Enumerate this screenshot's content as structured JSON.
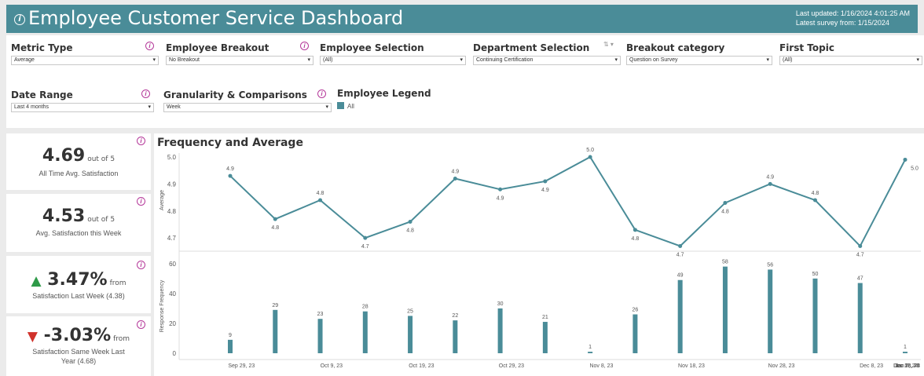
{
  "header": {
    "info_icon": "i",
    "title": "Employee Customer Service Dashboard",
    "last_updated": "Last updated: 1/16/2024 4:01:25 AM",
    "latest_survey": "Latest survey from: 1/15/2024"
  },
  "filters": {
    "metric_type": {
      "label": "Metric Type",
      "value": "Average"
    },
    "employee_breakout": {
      "label": "Employee Breakout",
      "value": "No Breakout"
    },
    "employee_selection": {
      "label": "Employee Selection",
      "value": "(All)"
    },
    "department_selection": {
      "label": "Department Selection",
      "value": "Continuing Certification"
    },
    "breakout_category": {
      "label": "Breakout category",
      "value": "Question on Survey"
    },
    "first_topic": {
      "label": "First Topic",
      "value": "(All)"
    },
    "date_range": {
      "label": "Date Range",
      "value": "Last 4 months"
    },
    "granularity": {
      "label": "Granularity & Comparisons",
      "value": "Week"
    },
    "employee_legend": {
      "label": "Employee Legend",
      "item": "All"
    }
  },
  "kpis": [
    {
      "value": "4.69",
      "suffix": "out of 5",
      "caption": "All Time Avg. Satisfaction"
    },
    {
      "value": "4.53",
      "suffix": "out of 5",
      "caption": "Avg. Satisfaction this Week"
    },
    {
      "arrow": "▲",
      "value": "3.47%",
      "suffix": "from",
      "caption": "Satisfaction Last Week (4.38)"
    },
    {
      "arrow": "▼",
      "value": "-3.03%",
      "suffix": "from",
      "caption": "Satisfaction Same Week Last Year (4.68)"
    }
  ],
  "chart_data": [
    {
      "type": "line",
      "title": "Frequency and Average",
      "ylabel": "Average",
      "ylim": [
        4.68,
        5.0
      ],
      "yticks": [
        "5.0",
        "4.9",
        "4.8",
        "4.7"
      ],
      "x": [
        "Sep 24, 23",
        "Sep 29, 23",
        "Oct 4, 23",
        "Oct 9, 23",
        "Oct 14, 23",
        "Oct 19, 23",
        "Oct 24, 23",
        "Oct 29, 23",
        "Nov 3, 23",
        "Nov 8, 23",
        "Nov 13, 23",
        "Nov 18, 23",
        "Nov 23, 23",
        "Nov 28, 23",
        "Dec 3, 23",
        "Dec 8, 23",
        "Dec 13, 23",
        "Dec 18, 23",
        "Dec 23, 23",
        "Dec 28, 23",
        "Jan 2, 24",
        "Jan 7, 24",
        "Jan 12, 24"
      ],
      "values": [
        4.93,
        4.77,
        4.84,
        4.7,
        4.76,
        4.92,
        4.88,
        4.91,
        5.0,
        4.73,
        4.67,
        4.83,
        4.9,
        4.84,
        4.67,
        4.99
      ],
      "labels": [
        "4.9",
        "4.8",
        "4.8",
        "4.7",
        "4.8",
        "4.9",
        "4.9",
        "4.9",
        "5.0",
        "4.8",
        "4.7",
        "4.8",
        "4.9",
        "4.8",
        "4.7",
        "5.0"
      ],
      "color": "#4a8c98"
    },
    {
      "type": "bar",
      "ylabel": "Response Frequency",
      "ylim": [
        0,
        62
      ],
      "yticks": [
        "60",
        "40",
        "20",
        "0"
      ],
      "values": [
        9,
        29,
        23,
        28,
        25,
        22,
        30,
        21,
        1,
        26,
        49,
        58,
        56,
        50,
        47,
        1
      ],
      "labels": [
        "9",
        "29",
        "23",
        "28",
        "25",
        "22",
        "30",
        "21",
        "1",
        "26",
        "49",
        "58",
        "56",
        "50",
        "47",
        "1"
      ],
      "xticks": [
        "Sep 29, 23",
        "Oct 9, 23",
        "Oct 19, 23",
        "Oct 29, 23",
        "Nov 8, 23",
        "Nov 18, 23",
        "Nov 28, 23",
        "Dec 8, 23",
        "Dec 18, 23",
        "Dec 28, 23",
        "Jan 7, 24",
        "Jan 17, 24"
      ],
      "color": "#4a8c98"
    }
  ]
}
